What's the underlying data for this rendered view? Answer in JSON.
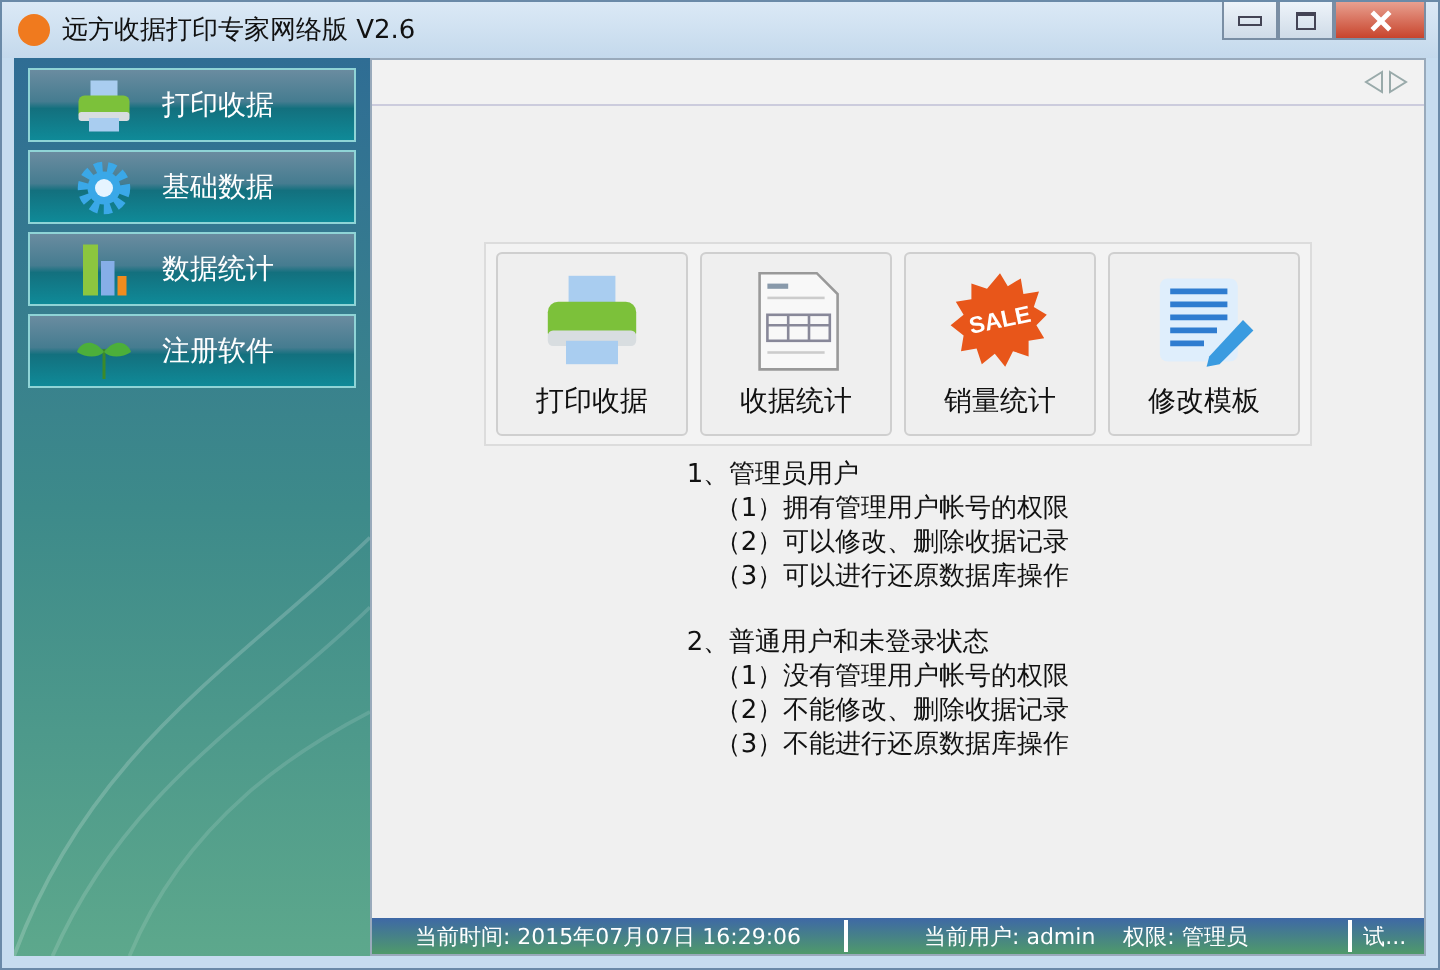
{
  "window": {
    "title": "远方收据打印专家网络版 V2.6"
  },
  "sidebar": {
    "items": [
      {
        "label": "打印收据",
        "kind": "printer"
      },
      {
        "label": "基础数据",
        "kind": "gear"
      },
      {
        "label": "数据统计",
        "kind": "bars"
      },
      {
        "label": "注册软件",
        "kind": "sprout"
      }
    ]
  },
  "tiles": [
    {
      "label": "打印收据",
      "kind": "printer"
    },
    {
      "label": "收据统计",
      "kind": "document"
    },
    {
      "label": "销量统计",
      "kind": "sale"
    },
    {
      "label": "修改模板",
      "kind": "notepad"
    }
  ],
  "sale_badge": "SALE",
  "notes": [
    {
      "heading": "1、管理员用户",
      "items": [
        "（1）拥有管理用户帐号的权限",
        "（2）可以修改、删除收据记录",
        "（3）可以进行还原数据库操作"
      ]
    },
    {
      "heading": "2、普通用户和未登录状态",
      "items": [
        "（1）没有管理用户帐号的权限",
        "（2）不能修改、删除收据记录",
        "（3）不能进行还原数据库操作"
      ]
    }
  ],
  "status_bar": {
    "time": "当前时间: 2015年07月07日 16:29:06",
    "user": "当前用户: admin",
    "role": "权限: 管理员",
    "extra": "试..."
  }
}
